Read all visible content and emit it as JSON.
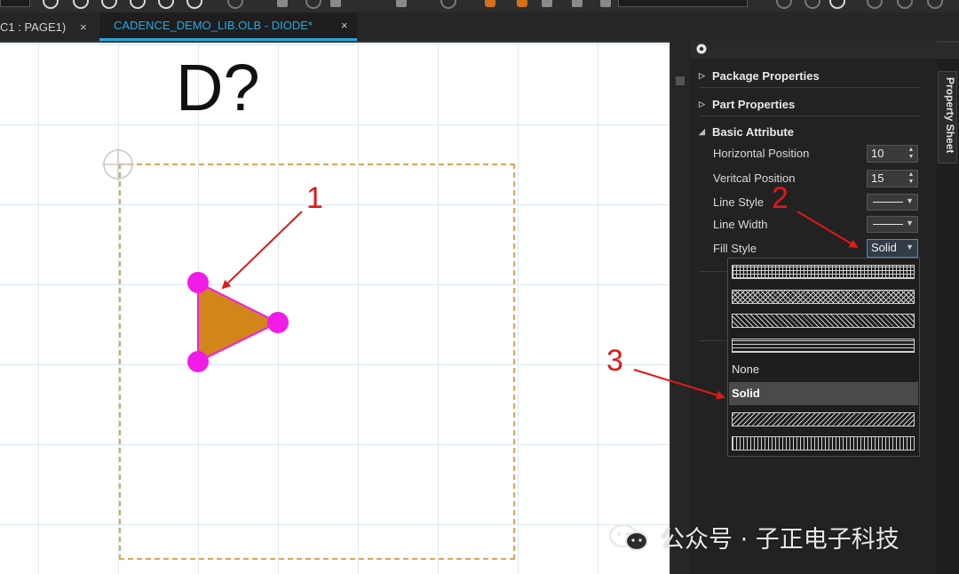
{
  "tabs": [
    {
      "label": "C1 : PAGE1)",
      "close": "×"
    },
    {
      "label": "CADENCE_DEMO_LIB.OLB - DIODE*",
      "close": "×"
    }
  ],
  "canvas": {
    "part_reference": "D?",
    "shape_fill_color": "#d2861a",
    "vertex_color": "#f21be8",
    "body_outline_color": "#d9a55c"
  },
  "property_sheet": {
    "side_tab_label": "Property Sheet",
    "sections": [
      {
        "label": "Package Properties",
        "expanded": false
      },
      {
        "label": "Part Properties",
        "expanded": false
      },
      {
        "label": "Basic Attribute",
        "expanded": true
      }
    ],
    "rows": {
      "horizontal_position": {
        "label": "Horizontal Position",
        "value": "10"
      },
      "vertical_position": {
        "label": "Veritcal Position",
        "value": "15"
      },
      "line_style": {
        "label": "Line Style"
      },
      "line_width": {
        "label": "Line Width"
      },
      "fill_style": {
        "label": "Fill Style",
        "value": "Solid"
      }
    }
  },
  "fill_style_dropdown": {
    "options": [
      {
        "kind": "pattern",
        "pattern": "grid"
      },
      {
        "kind": "pattern",
        "pattern": "crosshatch"
      },
      {
        "kind": "pattern",
        "pattern": "diagonal"
      },
      {
        "kind": "pattern",
        "pattern": "horizontal"
      },
      {
        "kind": "text",
        "label": "None"
      },
      {
        "kind": "text",
        "label": "Solid",
        "selected": true
      },
      {
        "kind": "pattern",
        "pattern": "backward-diagonal"
      },
      {
        "kind": "pattern",
        "pattern": "vertical"
      }
    ]
  },
  "annotations": {
    "one": "1",
    "two": "2",
    "three": "3",
    "color": "#e01818"
  },
  "watermark": {
    "text": "公众号 · 子正电子科技",
    "icon": "wechat-icon"
  }
}
